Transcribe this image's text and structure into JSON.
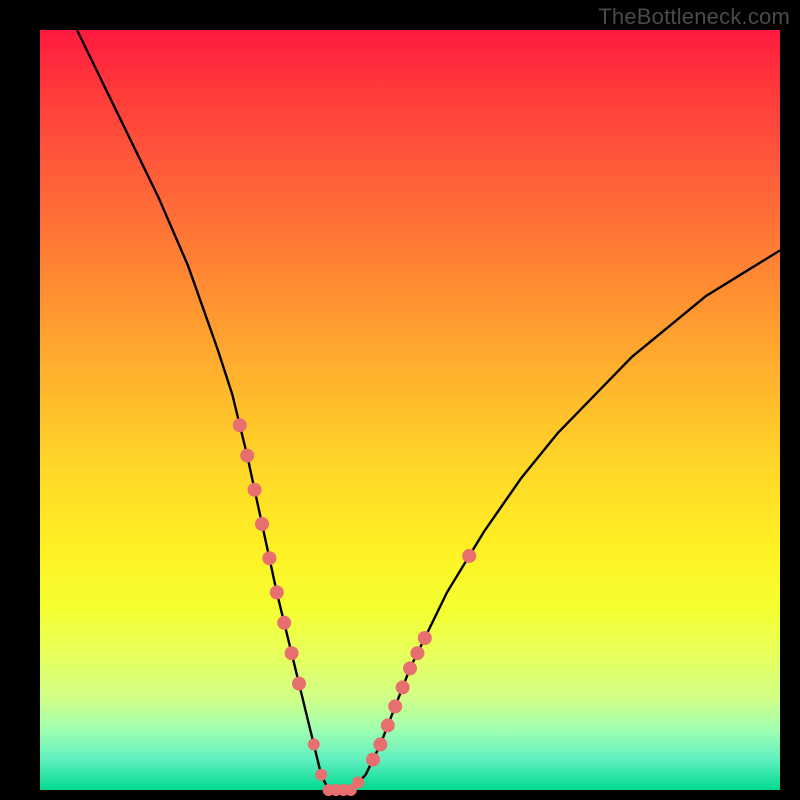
{
  "watermark": "TheBottleneck.com",
  "chart_data": {
    "type": "line",
    "title": "",
    "xlabel": "",
    "ylabel": "",
    "xlim": [
      0,
      100
    ],
    "ylim": [
      0,
      100
    ],
    "grid": false,
    "series": [
      {
        "name": "bottleneck-curve",
        "x": [
          5,
          8,
          12,
          16,
          20,
          24,
          26,
          28,
          30,
          32,
          34,
          36,
          37,
          38,
          39,
          40,
          42,
          44,
          46,
          48,
          50,
          55,
          60,
          65,
          70,
          75,
          80,
          85,
          90,
          95,
          100
        ],
        "y": [
          100,
          94,
          86,
          78,
          69,
          58,
          52,
          44,
          35,
          26,
          18,
          10,
          6,
          2,
          0,
          0,
          0,
          2,
          6,
          11,
          16,
          26,
          34,
          41,
          47,
          52,
          57,
          61,
          65,
          68,
          71
        ]
      }
    ],
    "marker_points": {
      "comment": "salmon dot clusters on the curve",
      "left_cluster_x": [
        27,
        28,
        29,
        30,
        31,
        32,
        33,
        34,
        35
      ],
      "right_cluster_x": [
        45,
        46,
        47,
        48,
        49,
        50,
        51,
        52,
        58
      ],
      "bottom_cluster_x": [
        37,
        38,
        39,
        40,
        41,
        42,
        43
      ]
    },
    "colors": {
      "curve": "#000000",
      "markers": "#e76f6f",
      "gradient_top": "#ff1a40",
      "gradient_bottom": "#00d890"
    }
  }
}
